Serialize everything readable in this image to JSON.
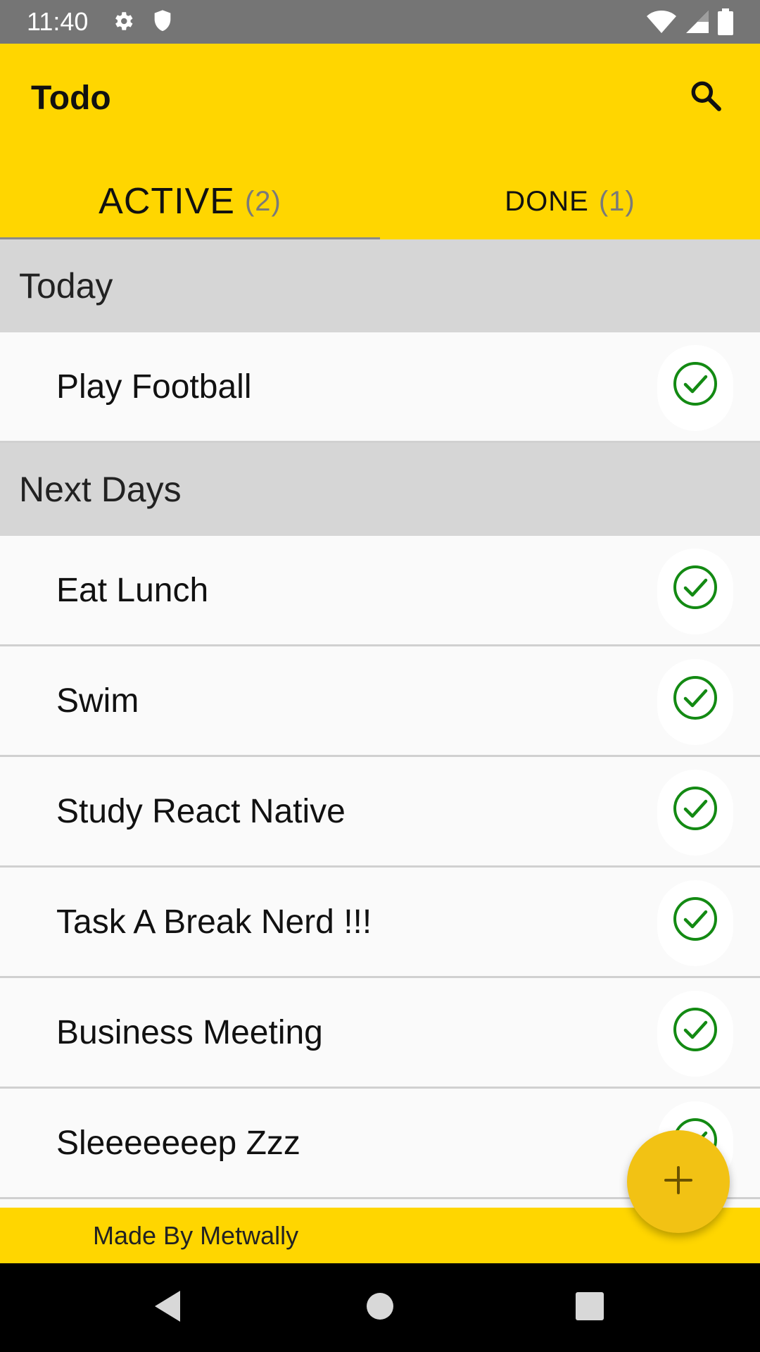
{
  "status_bar": {
    "time": "11:40",
    "left_icons": [
      "gear-icon",
      "shield-icon"
    ],
    "right_icons": [
      "wifi-icon",
      "signal-icon",
      "battery-icon"
    ]
  },
  "app_bar": {
    "title": "Todo",
    "search_icon": "search-icon"
  },
  "tabs": [
    {
      "label": "ACTIVE",
      "count": "(2)",
      "selected": true
    },
    {
      "label": "DONE",
      "count": "(1)",
      "selected": false
    }
  ],
  "sections": [
    {
      "title": "Today",
      "items": [
        {
          "label": "Play Football"
        }
      ]
    },
    {
      "title": "Next Days",
      "items": [
        {
          "label": "Eat Lunch"
        },
        {
          "label": "Swim"
        },
        {
          "label": "Study React Native"
        },
        {
          "label": "Task A Break Nerd !!!"
        },
        {
          "label": "Business Meeting"
        },
        {
          "label": "Sleeeeeeep Zzz"
        }
      ]
    }
  ],
  "footer": {
    "text": "Made By Metwally"
  },
  "fab": {
    "icon": "plus-icon"
  },
  "colors": {
    "accent": "#ffd600",
    "fab": "#f2c214",
    "check": "#138a13",
    "section_bg": "#d6d6d6"
  }
}
